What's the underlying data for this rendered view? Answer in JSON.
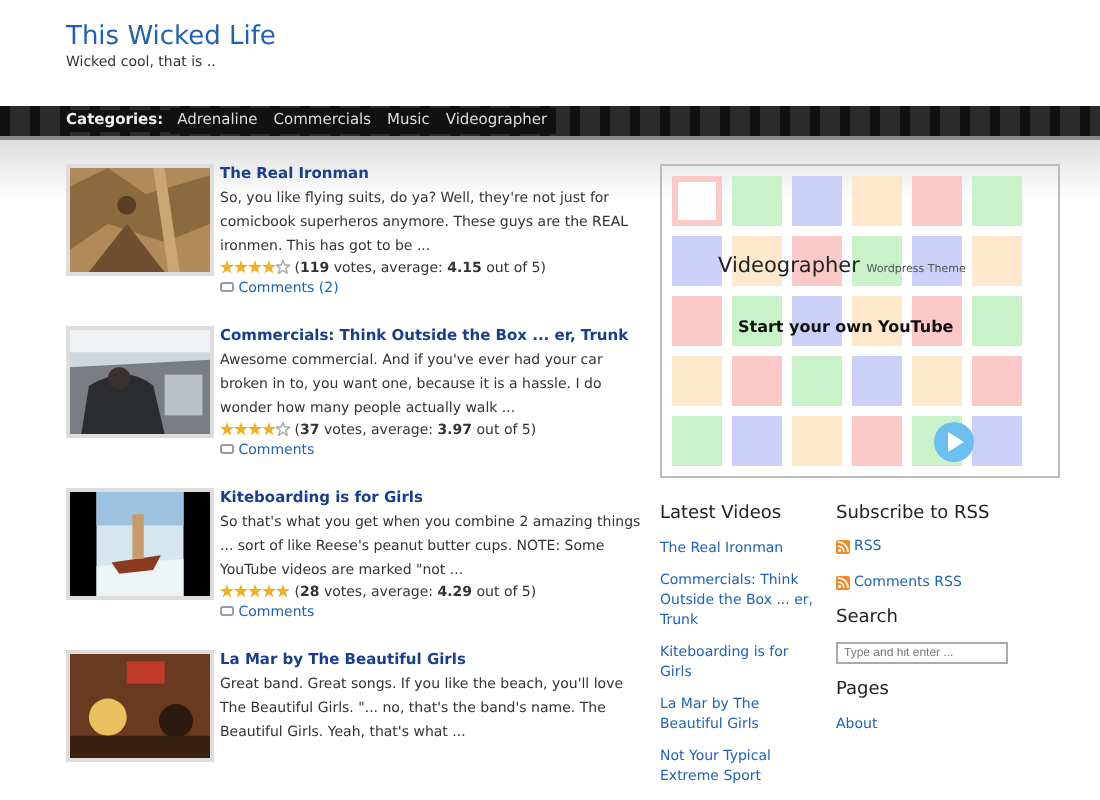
{
  "site": {
    "title": "This Wicked Life",
    "tagline": "Wicked cool, that is .."
  },
  "nav": {
    "label": "Categories:",
    "items": [
      "Adrenaline",
      "Commercials",
      "Music",
      "Videographer"
    ]
  },
  "posts": [
    {
      "title": "The Real Ironman",
      "excerpt": "So, you like flying suits, do ya? Well, they're not just for comicbook superheros anymore. These guys are the REAL ironmen. This has got to be ...",
      "stars": 4,
      "rating": "(**119** votes, average: **4.15** out of 5)",
      "comments": "Comments (2)"
    },
    {
      "title": "Commercials: Think Outside the Box ... er, Trunk",
      "excerpt": "Awesome commercial. And if you've ever had your car broken in to, you want one, because it is a hassle. I do wonder how many people actually walk ...",
      "stars": 4,
      "rating": "(**37** votes, average: **3.97** out of 5)",
      "comments": "Comments"
    },
    {
      "title": "Kiteboarding is for Girls",
      "excerpt": "So that's what you get when you combine 2 amazing things ... sort of like Reese's peanut butter cups. NOTE: Some YouTube videos are marked \"not ...",
      "stars": 5,
      "rating": "(**28** votes, average: **4.29** out of 5)",
      "comments": "Comments"
    },
    {
      "title": "La Mar by The Beautiful Girls",
      "excerpt": "Great band. Great songs. If you like the beach, you'll love The Beautiful Girls. \"... no, that's the band's name. The Beautiful Girls. Yeah, that's what ..."
    }
  ],
  "ad": {
    "title": "Videographer",
    "subtitle": "Wordpress Theme",
    "tagline": "Start your own YouTube"
  },
  "latest_videos": {
    "heading": "Latest Videos",
    "items": [
      "The Real Ironman",
      "Commercials: Think Outside the Box ... er, Trunk",
      "Kiteboarding is for Girls",
      "La Mar by The Beautiful Girls",
      "Not Your Typical Extreme Sport"
    ]
  },
  "rss": {
    "heading": "Subscribe to RSS",
    "items": [
      "RSS",
      "Comments RSS"
    ]
  },
  "search": {
    "heading": "Search",
    "placeholder": "Type and hit enter ..."
  },
  "pages": {
    "heading": "Pages",
    "items": [
      "About"
    ]
  }
}
